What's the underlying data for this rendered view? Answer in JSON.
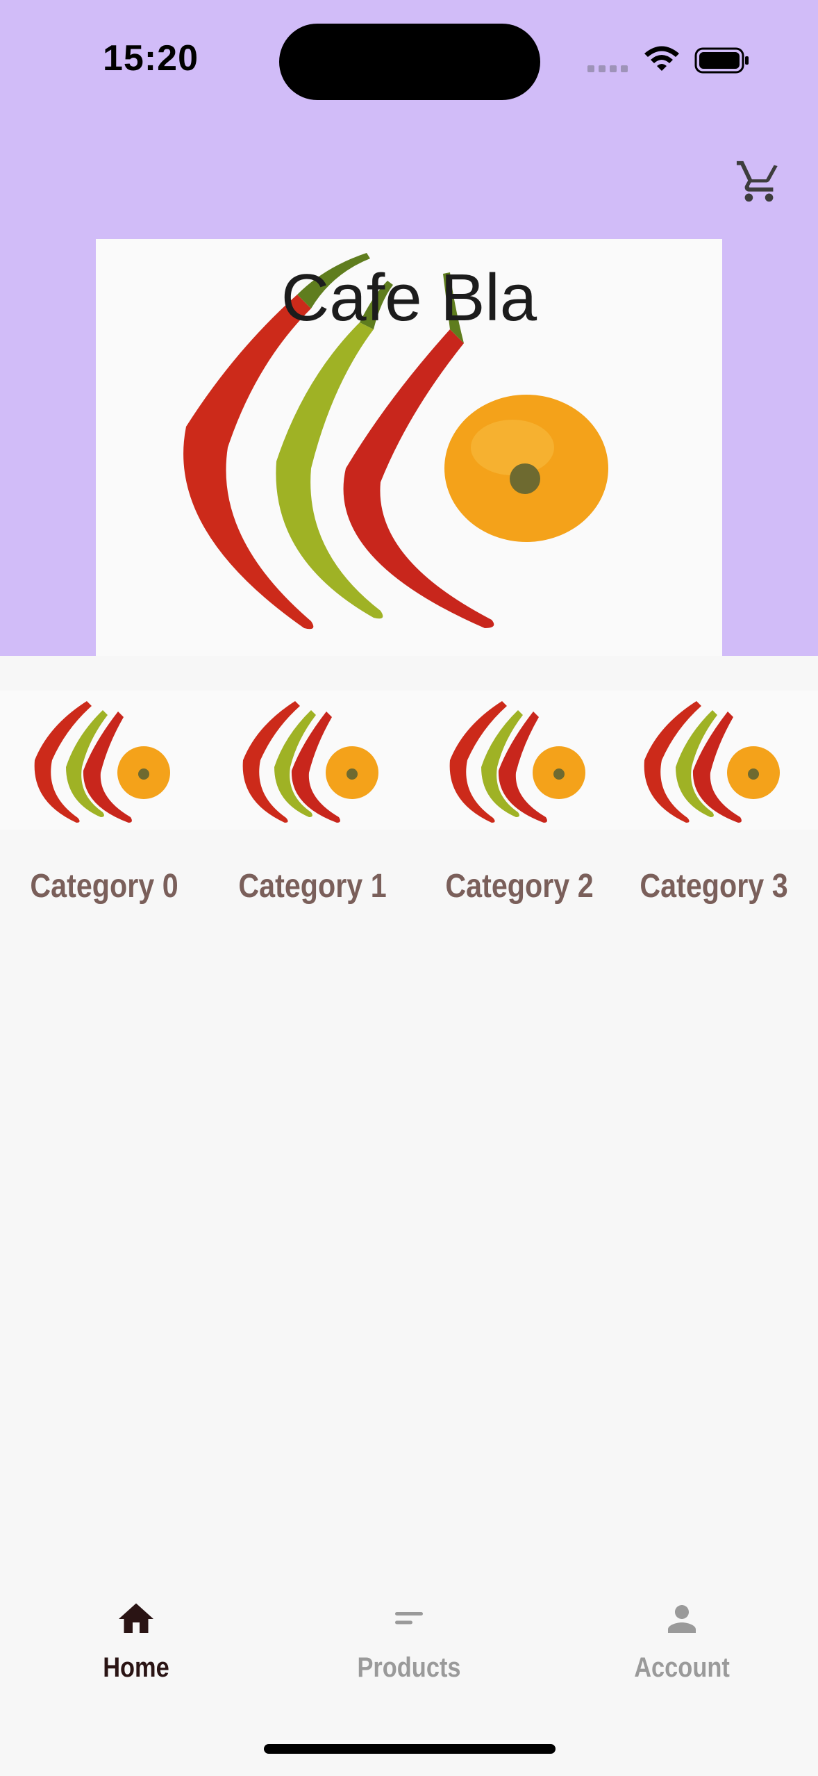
{
  "status_bar": {
    "time": "15:20"
  },
  "header": {
    "cart_icon": "shopping-cart-icon",
    "background_color": "#d1bcf8"
  },
  "hero": {
    "title": "Cafe Bla",
    "image": "chili-peppers-image"
  },
  "categories": [
    {
      "label": "Category 0"
    },
    {
      "label": "Category 1"
    },
    {
      "label": "Category 2"
    },
    {
      "label": "Category 3"
    }
  ],
  "bottom_nav": {
    "items": [
      {
        "label": "Home",
        "icon": "home-icon",
        "active": true
      },
      {
        "label": "Products",
        "icon": "list-icon",
        "active": false
      },
      {
        "label": "Account",
        "icon": "person-icon",
        "active": false
      }
    ]
  },
  "colors": {
    "accent": "#d1bcf8",
    "category_label": "#7a5f5a",
    "nav_active": "#2a1414",
    "nav_inactive": "#9a9a9a"
  }
}
